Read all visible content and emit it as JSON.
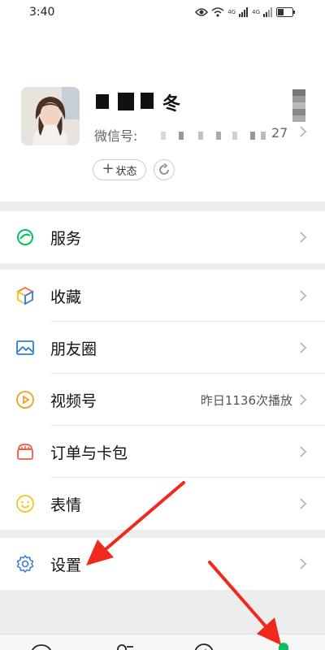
{
  "status_bar": {
    "time": "3:40",
    "signal_1_label": "4G",
    "signal_2_label": "4G"
  },
  "profile": {
    "name_visible_part": "冬",
    "wechat_id_label": "微信号: ",
    "wechat_id_visible_tail": "27",
    "status_button_label": "状态"
  },
  "menu": {
    "group_services": [
      {
        "label": "服务",
        "icon": "services-icon",
        "color": "#07c160"
      }
    ],
    "group_main": [
      {
        "label": "收藏",
        "icon": "favorites-cube-icon",
        "color": "#ff6b3d"
      },
      {
        "label": "朋友圈",
        "icon": "moments-image-icon",
        "color": "#2e7dd7"
      },
      {
        "label": "视频号",
        "icon": "channels-play-icon",
        "color": "#f0a020",
        "extra": "昨日1136次播放"
      },
      {
        "label": "订单与卡包",
        "icon": "orders-wallet-icon",
        "color": "#f05a4a"
      },
      {
        "label": "表情",
        "icon": "stickers-smile-icon",
        "color": "#f5c518"
      }
    ],
    "group_settings": [
      {
        "label": "设置",
        "icon": "settings-gear-icon",
        "color": "#3a7bd5"
      }
    ]
  },
  "colors": {
    "accent_green": "#07c160",
    "annotation_red": "#f0281e"
  }
}
